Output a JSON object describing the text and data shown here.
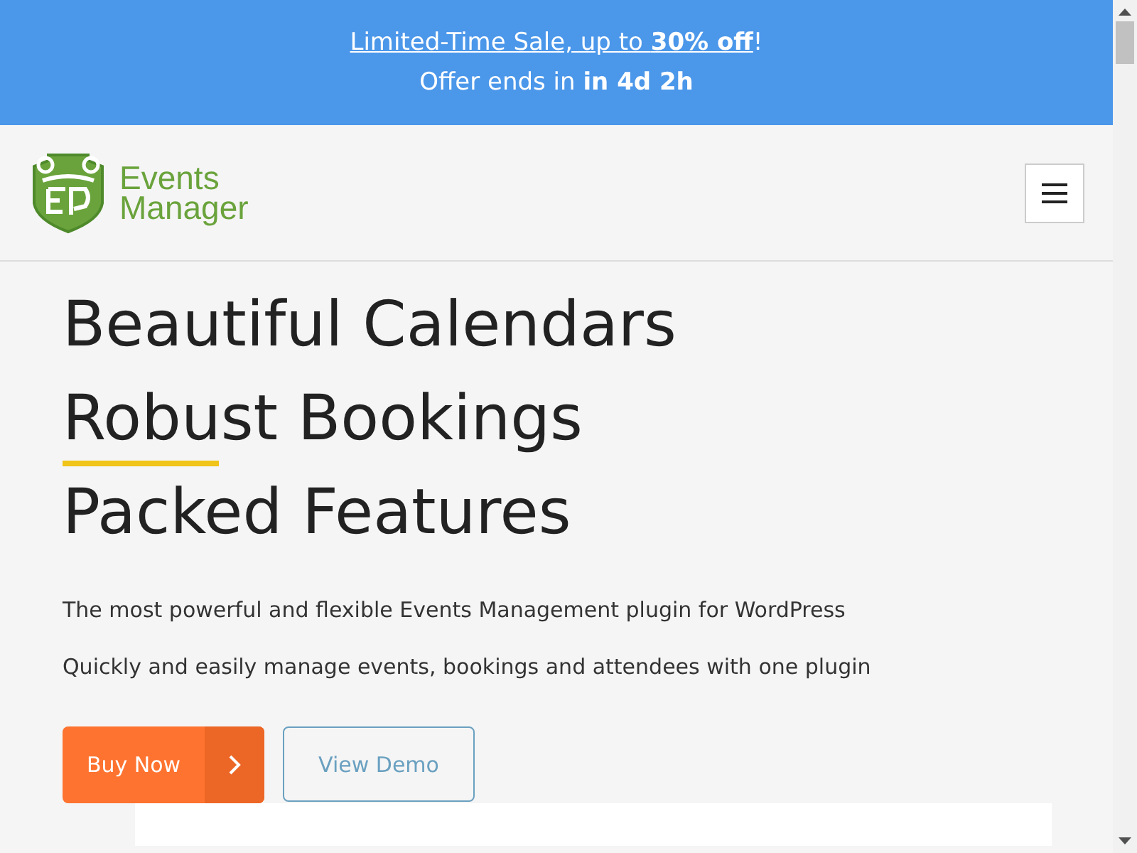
{
  "banner": {
    "link": "Limited-Time Sale, up to **30% off**",
    "suffix": "!",
    "countdown": "Offer ends in **in 4d 2h**"
  },
  "header": {
    "logo_text": [
      "Events",
      "Manager"
    ]
  },
  "hero": {
    "headlines": [
      "Beautiful Calendars",
      "Robust Bookings",
      "Packed Features"
    ],
    "paragraphs": [
      "The most powerful and flexible Events Management plugin for WordPress",
      "Quickly and easily manage events, bookings and attendees with one plugin"
    ],
    "buttons": [
      {
        "label": "Buy Now",
        "kind": "primary"
      },
      {
        "label": "View Demo",
        "kind": "outline"
      }
    ]
  }
}
